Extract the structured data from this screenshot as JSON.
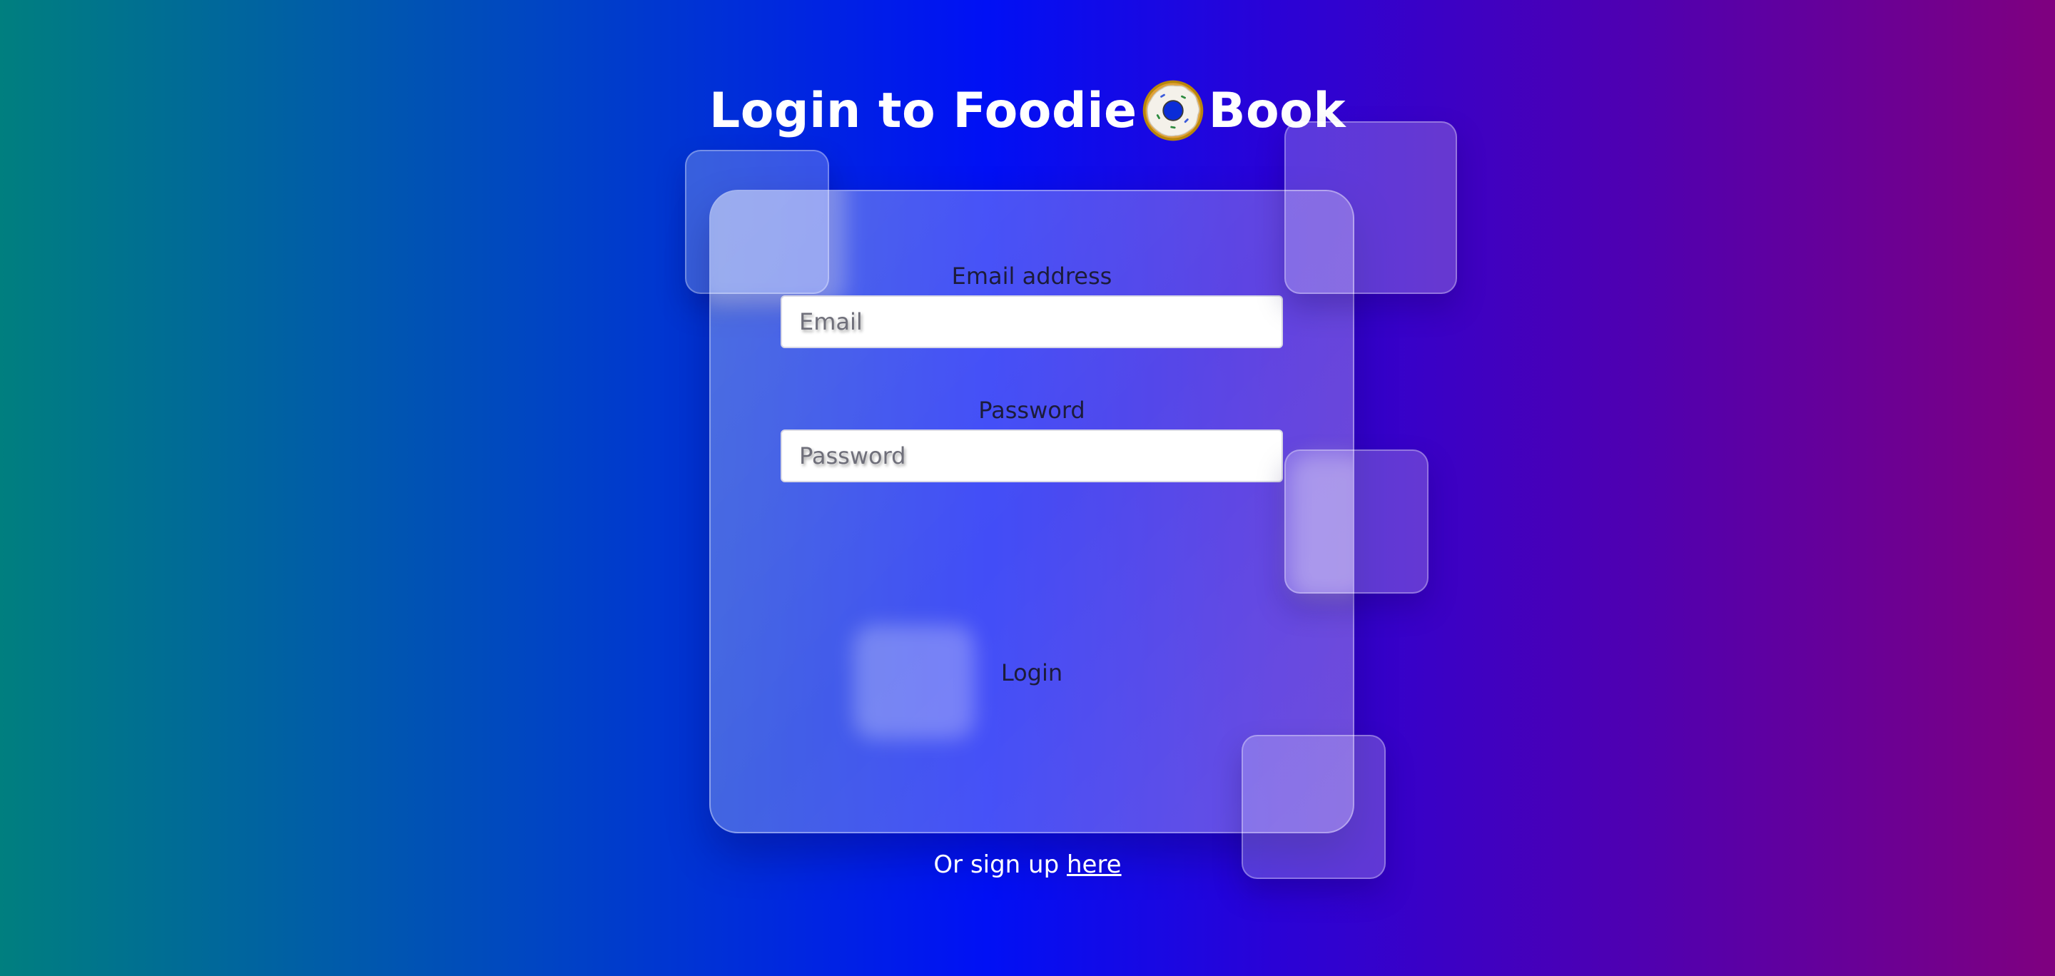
{
  "header": {
    "title_before": "Login to Foodie",
    "title_after": "Book",
    "logo_icon": "donut-icon"
  },
  "form": {
    "email_label": "Email address",
    "email_placeholder": "Email",
    "email_value": "",
    "password_label": "Password",
    "password_placeholder": "Password",
    "password_value": "",
    "login_label": "Login"
  },
  "footer": {
    "signup_text": "Or sign up",
    "signup_link": "here"
  },
  "colors": {
    "gradient_left": "#007f7f",
    "gradient_center": "#0010f5",
    "gradient_right": "#7f007f",
    "text_on_card": "#1c1c3a"
  }
}
